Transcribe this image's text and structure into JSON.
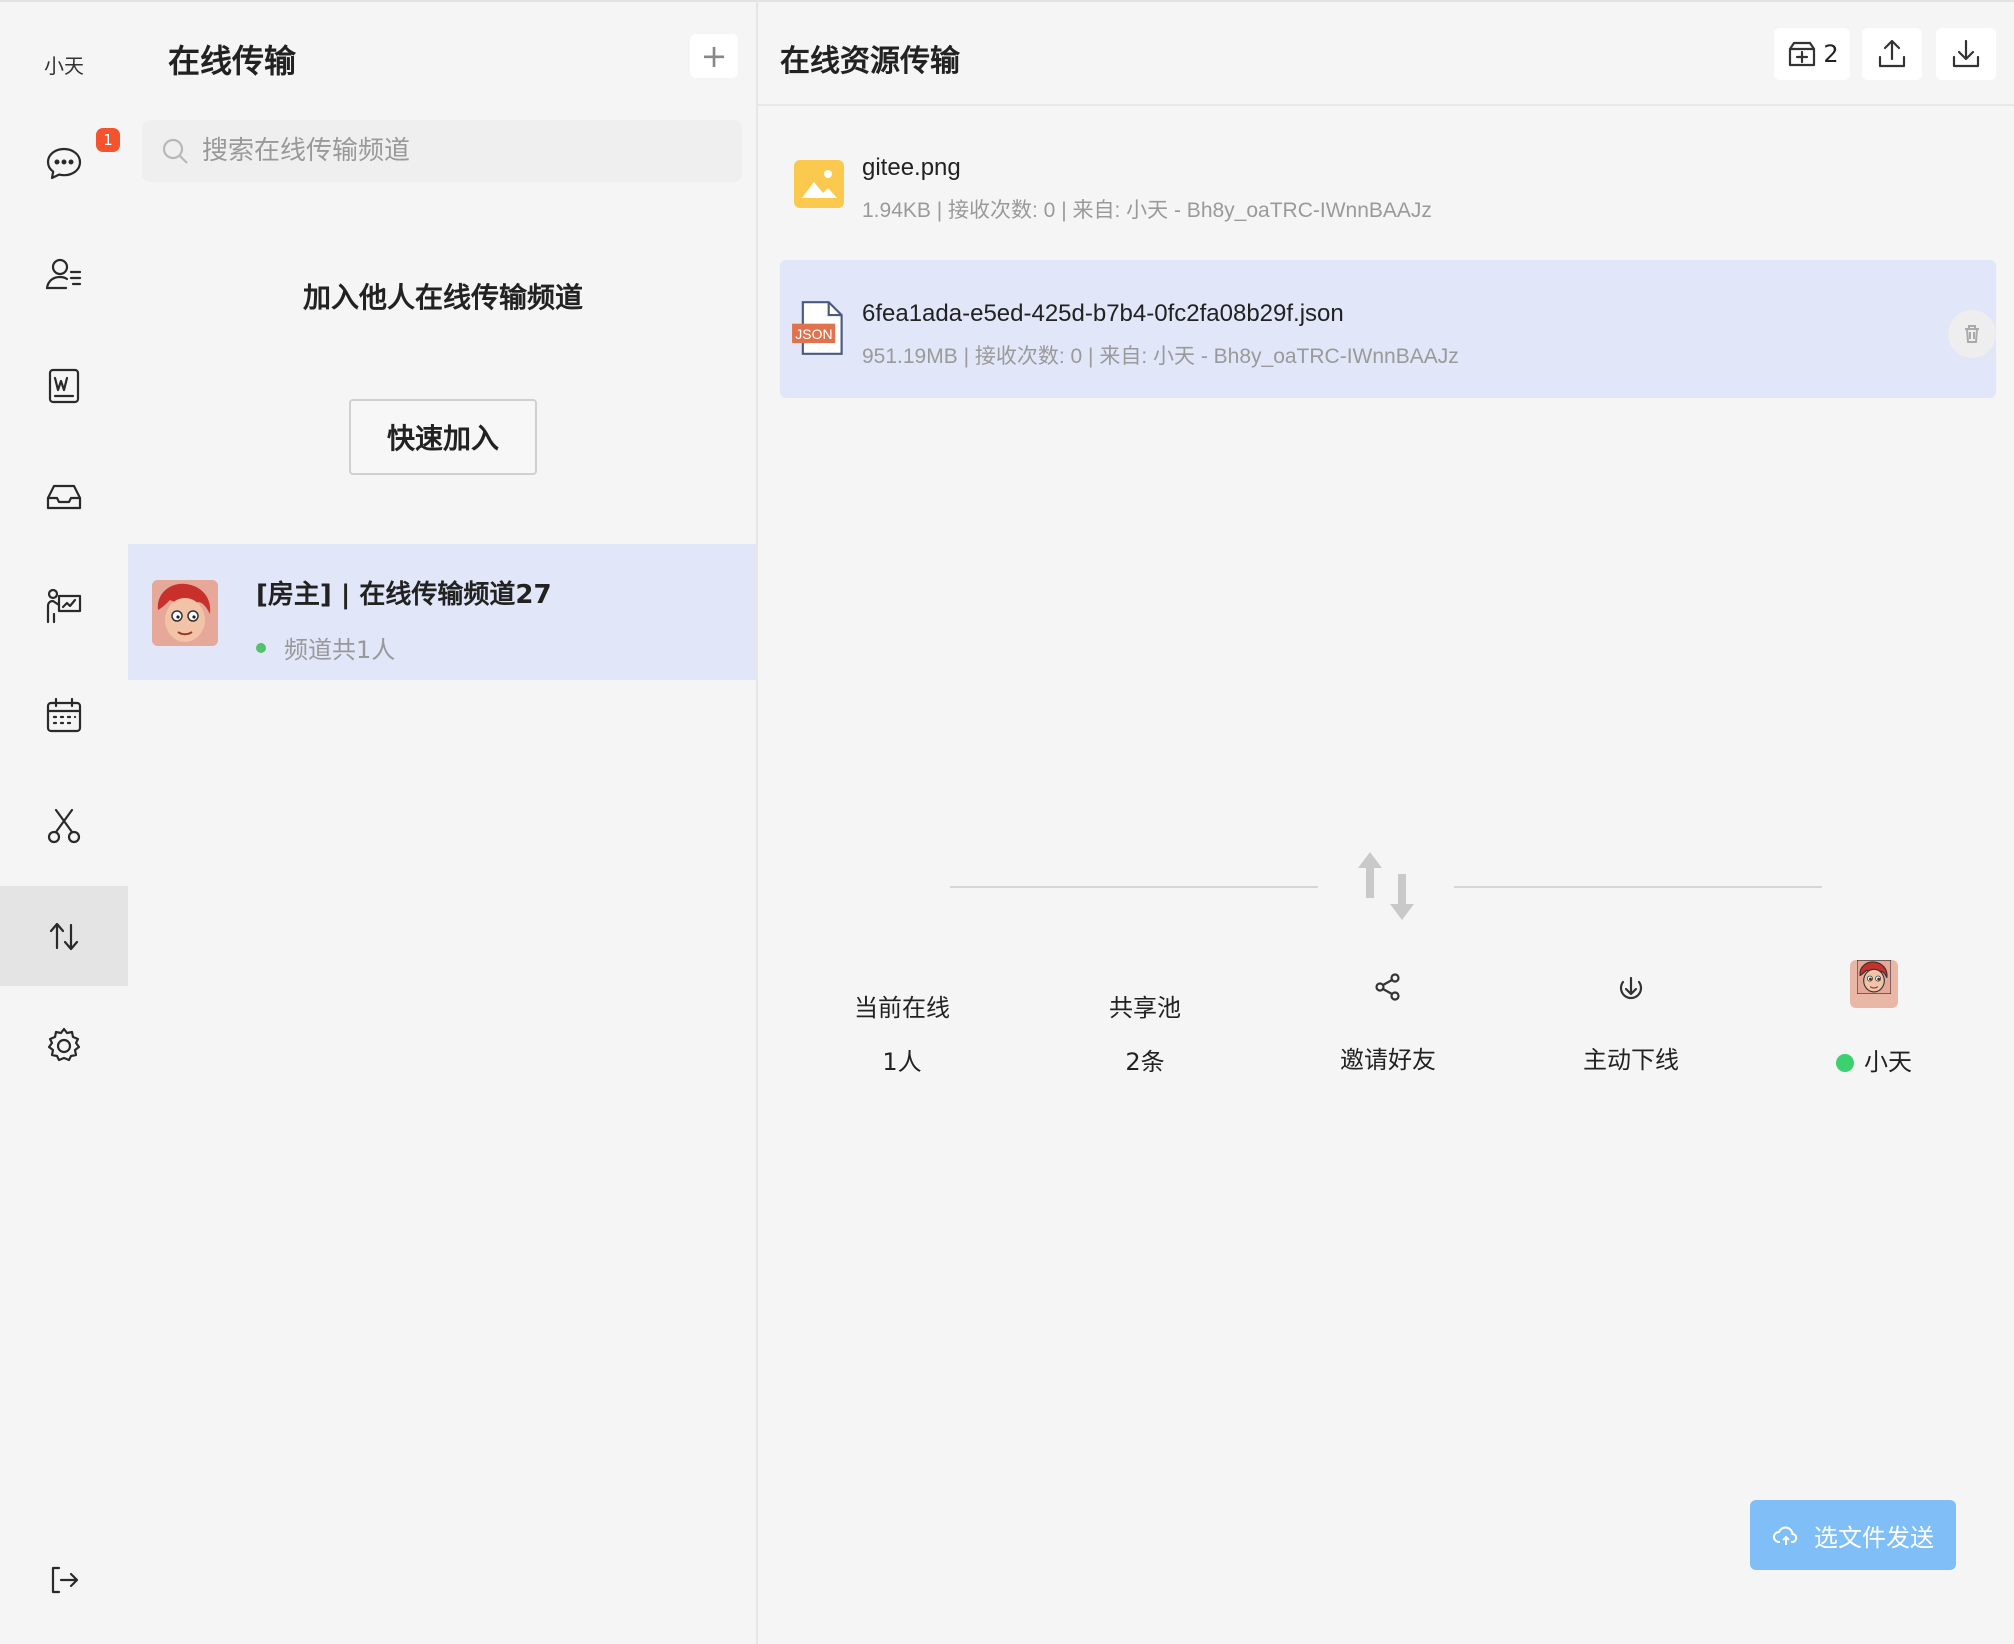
{
  "rail": {
    "username": "小天",
    "badge_count": "1",
    "items": [
      {
        "icon": "chat-icon"
      },
      {
        "icon": "contacts-icon"
      },
      {
        "icon": "word-doc-icon"
      },
      {
        "icon": "inbox-icon"
      },
      {
        "icon": "presentation-icon"
      },
      {
        "icon": "calendar-icon"
      },
      {
        "icon": "scissors-icon"
      },
      {
        "icon": "transfer-icon",
        "active": true
      },
      {
        "icon": "gear-icon"
      }
    ],
    "logout_icon": "logout-icon"
  },
  "panel": {
    "title": "在线传输",
    "add_label": "+",
    "search_placeholder": "搜索在线传输频道",
    "join_title": "加入他人在线传输频道",
    "quick_join_label": "快速加入",
    "channels": [
      {
        "name": "[房主] | 在线传输频道27",
        "members": "频道共1人"
      }
    ]
  },
  "main": {
    "title": "在线资源传输",
    "pool_count": "2",
    "files": [
      {
        "name": "gitee.png",
        "meta": "1.94KB | 接收次数: 0 | 来自: 小天 - Bh8y_oaTRC-IWnnBAAJz",
        "type": "image"
      },
      {
        "name": "6fea1ada-e5ed-425d-b7b4-0fc2fa08b29f.json",
        "meta": "951.19MB | 接收次数: 0 | 来自: 小天 - Bh8y_oaTRC-IWnnBAAJz",
        "type": "json",
        "type_label": "JSON"
      }
    ],
    "stats": {
      "online_label": "当前在线",
      "online_value": "1人",
      "pool_label": "共享池",
      "pool_value": "2条",
      "invite_label": "邀请好友",
      "offline_label": "主动下线",
      "user_name": "小天"
    },
    "send_label": "选文件发送"
  },
  "colors": {
    "accent": "#7fbef7",
    "selected_bg": "#e1e6f8",
    "badge": "#f5532d",
    "online": "#3bd16f"
  }
}
